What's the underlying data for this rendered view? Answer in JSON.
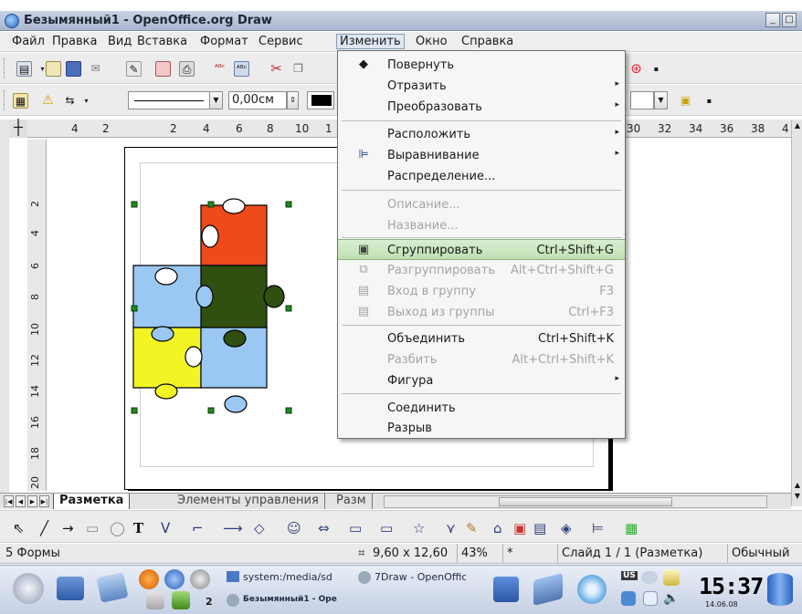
{
  "window": {
    "title": "Безымянный1 - OpenOffice.org Draw",
    "minimize": "_",
    "maximize": "□"
  },
  "menubar": [
    {
      "label": "Файл"
    },
    {
      "label": "Правка"
    },
    {
      "label": "Вид"
    },
    {
      "label": "Вставка"
    },
    {
      "label": "Формат"
    },
    {
      "label": "Сервис"
    },
    {
      "label": "Изменить"
    },
    {
      "label": "Окно"
    },
    {
      "label": "Справка"
    }
  ],
  "toolbar2": {
    "linewidth_value": "0,00см"
  },
  "ruler": {
    "h_ticks": [
      "4",
      "2",
      "2",
      "4",
      "6",
      "8",
      "10",
      "1",
      "30",
      "32",
      "34",
      "36",
      "38",
      "4"
    ],
    "v_ticks": [
      "2",
      "4",
      "6",
      "8",
      "10",
      "12",
      "14",
      "16",
      "18",
      "20"
    ]
  },
  "puzzle_colors": {
    "red": "#ee4a1c",
    "green": "#2f5010",
    "blue": "#9ac8f2",
    "yellow": "#f2f523"
  },
  "menu": {
    "items": [
      {
        "label": "Повернуть",
        "shortcut": "",
        "icon": "rotate-icon"
      },
      {
        "label": "Отразить",
        "shortcut": "",
        "icon": ""
      },
      {
        "label": "Преобразовать",
        "shortcut": "",
        "icon": ""
      },
      {
        "label": "Расположить",
        "shortcut": "",
        "icon": ""
      },
      {
        "label": "Выравнивание",
        "shortcut": "",
        "icon": "align-icon"
      },
      {
        "label": "Распределение...",
        "shortcut": "",
        "icon": ""
      },
      {
        "label": "Описание...",
        "shortcut": "",
        "icon": ""
      },
      {
        "label": "Название...",
        "shortcut": "",
        "icon": ""
      },
      {
        "label": "Сгруппировать",
        "shortcut": "Ctrl+Shift+G",
        "icon": "group-icon"
      },
      {
        "label": "Разгруппировать",
        "shortcut": "Alt+Ctrl+Shift+G",
        "icon": "ungroup-icon"
      },
      {
        "label": "Вход в группу",
        "shortcut": "F3",
        "icon": "enter-group-icon"
      },
      {
        "label": "Выход из группы",
        "shortcut": "Ctrl+F3",
        "icon": "exit-group-icon"
      },
      {
        "label": "Объединить",
        "shortcut": "Ctrl+Shift+K",
        "icon": ""
      },
      {
        "label": "Разбить",
        "shortcut": "Alt+Ctrl+Shift+K",
        "icon": ""
      },
      {
        "label": "Фигура",
        "shortcut": "",
        "icon": ""
      },
      {
        "label": "Соединить",
        "shortcut": "",
        "icon": ""
      },
      {
        "label": "Разрыв",
        "shortcut": "",
        "icon": ""
      }
    ]
  },
  "tabs": [
    {
      "label": "Разметка"
    },
    {
      "label": "Элементы управления"
    },
    {
      "label": "Разм"
    }
  ],
  "statusbar": {
    "selection": "5 Формы",
    "size": "9,60 x 12,60",
    "zoom": "43%",
    "modified": "*",
    "slide": "Слайд 1 / 1 (Разметка)",
    "layout": "Обычный"
  },
  "taskbar": {
    "tasks": [
      {
        "label": "system:/media/sd"
      },
      {
        "label": "7Draw - OpenOffic"
      },
      {
        "label": "Безымянный1 - Ope"
      }
    ],
    "desktop_number": "2",
    "clock": "15:37",
    "date": "14.06.08",
    "lang": "US"
  }
}
